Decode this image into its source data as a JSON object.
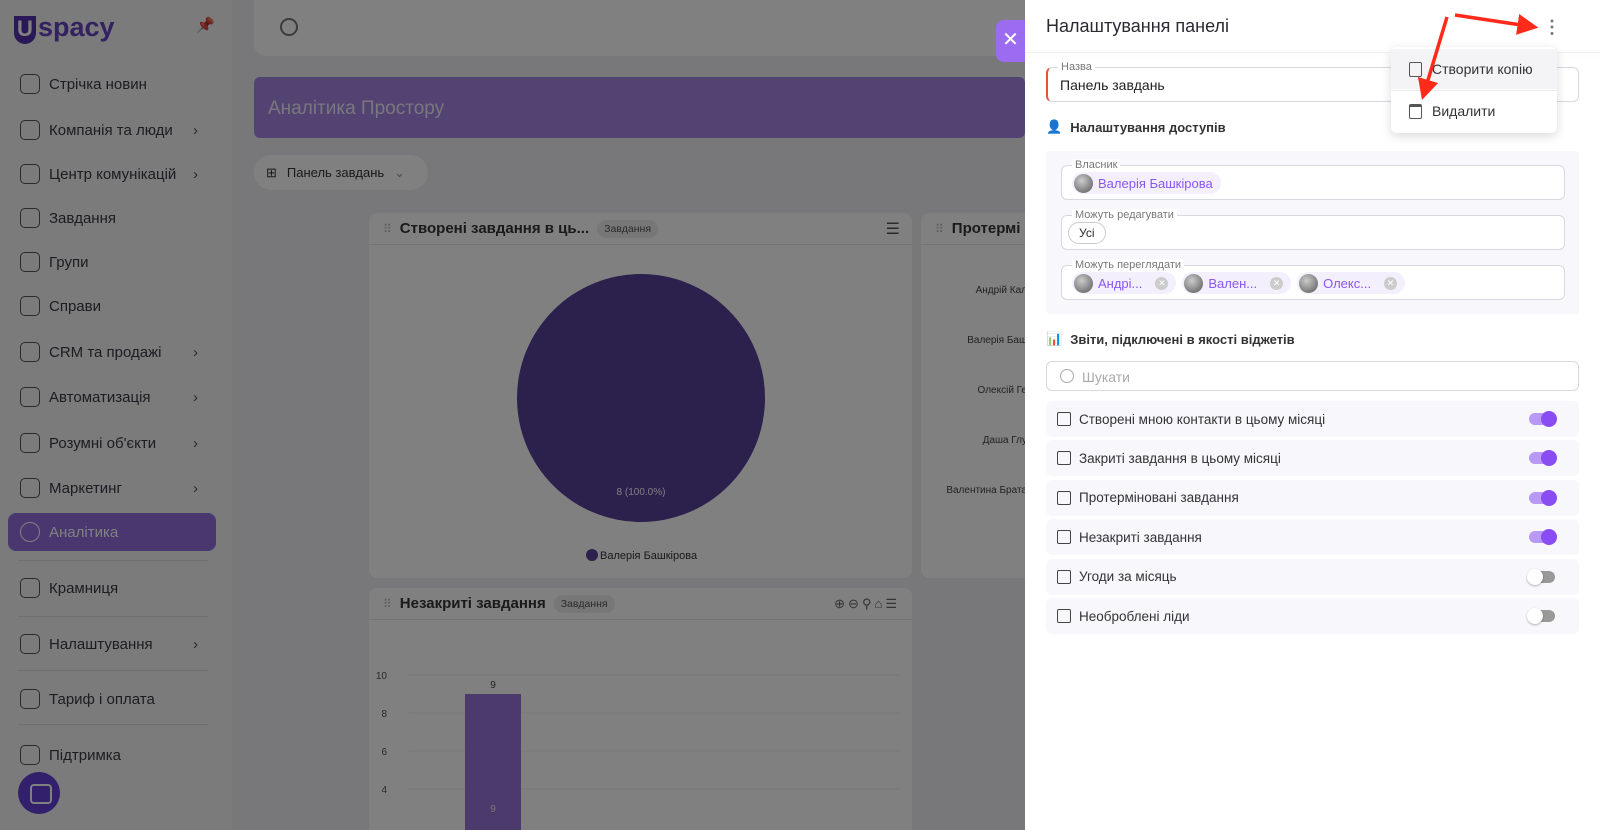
{
  "sidebar": {
    "logo": "Uspacy",
    "items": [
      {
        "label": "Стрічка новин",
        "chev": false
      },
      {
        "label": "Компанія та люди",
        "chev": true
      },
      {
        "label": "Центр комунікацій",
        "chev": true
      },
      {
        "label": "Завдання",
        "chev": false
      },
      {
        "label": "Групи",
        "chev": false
      },
      {
        "label": "Справи",
        "chev": false
      },
      {
        "label": "CRM та продажі",
        "chev": true
      },
      {
        "label": "Автоматизація",
        "chev": true
      },
      {
        "label": "Розумні об'єкти",
        "chev": true
      },
      {
        "label": "Маркетинг",
        "chev": true
      },
      {
        "label": "Аналітика",
        "chev": false,
        "active": true
      },
      {
        "label": "Крамниця",
        "chev": false
      },
      {
        "label": "Налаштування",
        "chev": true
      },
      {
        "label": "Тариф і оплата",
        "chev": false
      },
      {
        "label": "Підтримка",
        "chev": false
      }
    ]
  },
  "main": {
    "banner": "Аналітика Простору",
    "dashboard_select": "Панель завдань",
    "card1": {
      "title": "Створені завдання в ць...",
      "tag": "Завдання"
    },
    "card2": {
      "title": "Протермі",
      "labels": [
        "Андрій Кал",
        "Валерія Баш",
        "Олексій Ге",
        "Даша Глу",
        "Валентина Брата"
      ]
    },
    "card3": {
      "title": "Незакриті завдання",
      "tag": "Завдання"
    }
  },
  "chart_data": [
    {
      "type": "pie",
      "categories": [
        "Валерія Башкірова"
      ],
      "values": [
        8
      ],
      "labels": [
        "8 (100.0%)"
      ],
      "legend": "bottom"
    },
    {
      "type": "bar",
      "categories": [
        ""
      ],
      "values": [
        9
      ],
      "yticks": [
        "10",
        "8",
        "6",
        "4"
      ],
      "ylim": [
        0,
        10
      ],
      "data_labels": [
        "9",
        "9"
      ]
    }
  ],
  "panel": {
    "title": "Налаштування панелі",
    "close": "✕",
    "menu": [
      {
        "label": "Створити копію",
        "icon": "copy-icon"
      },
      {
        "label": "Видалити",
        "icon": "trash-icon"
      }
    ],
    "name_label": "Назва",
    "name_value": "Панель завдань",
    "access_heading": "Налаштування доступів",
    "owner_label": "Власник",
    "owner": "Валерія Башкірова",
    "edit_label": "Можуть редагувати",
    "edit_value": "Усі",
    "view_label": "Можуть переглядати",
    "viewers": [
      "Андрі...",
      "Вален...",
      "Олекс..."
    ],
    "reports_heading": "Звіти, підключені в якості віджетів",
    "search_placeholder": "Шукати",
    "reports": [
      {
        "label": "Створені мною контакти в цьому місяці",
        "on": true,
        "icon": "info-card-icon"
      },
      {
        "label": "Закриті завдання в цьому місяці",
        "on": true,
        "icon": "bar-chart-icon"
      },
      {
        "label": "Протерміновані завдання",
        "on": true,
        "icon": "horizontal-bar-icon"
      },
      {
        "label": "Незакриті завдання",
        "on": true,
        "icon": "bar-chart-icon"
      },
      {
        "label": "Угоди за місяць",
        "on": false,
        "icon": "bar-chart-icon"
      },
      {
        "label": "Необроблені ліди",
        "on": false,
        "icon": "horizontal-bar-icon"
      }
    ]
  },
  "colors": {
    "accent": "#8a4df3",
    "pie": "#5a3fa8",
    "annotation": "#ff2a1a"
  }
}
